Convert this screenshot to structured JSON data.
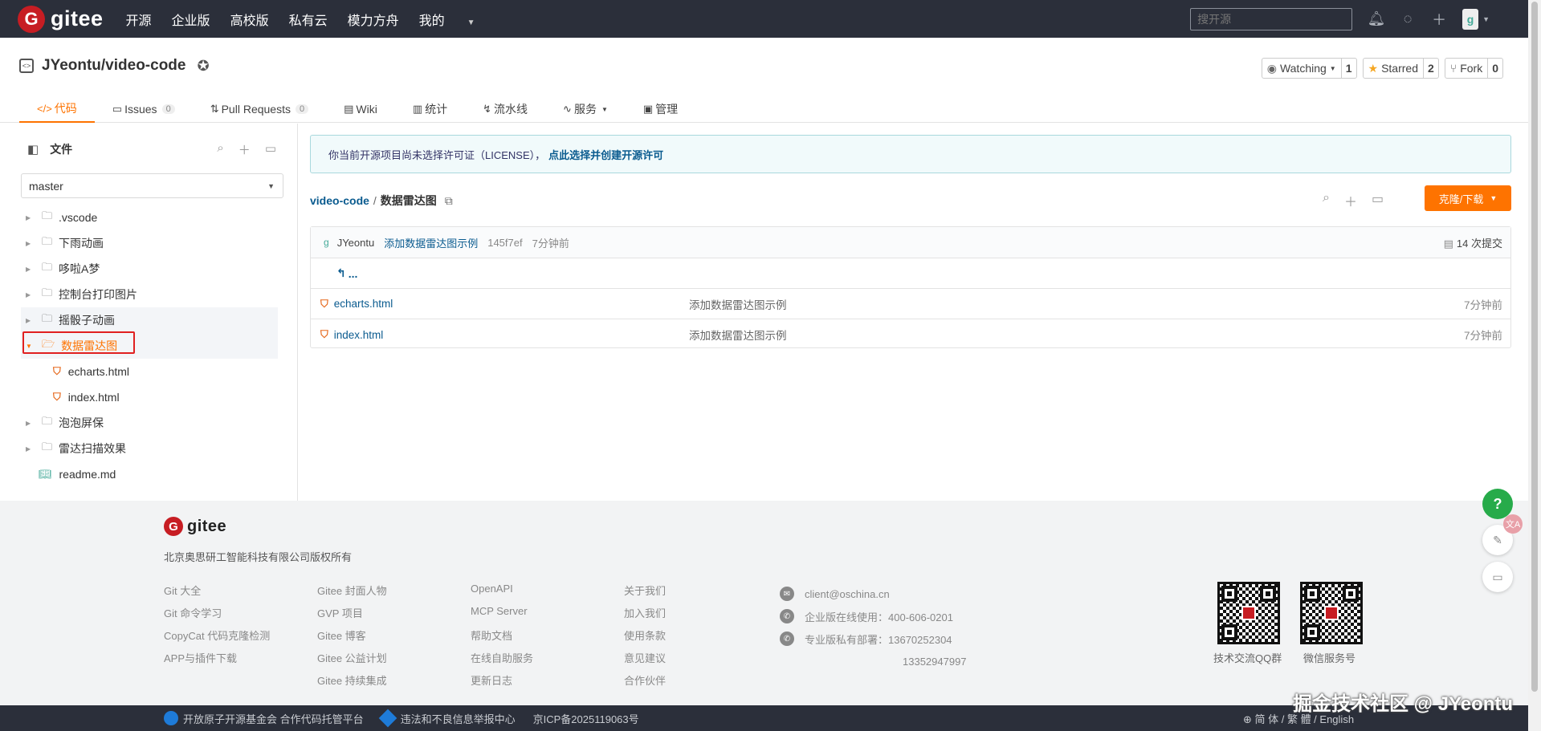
{
  "nav": {
    "logo_mark": "G",
    "logo_text": "gitee",
    "links": [
      "开源",
      "企业版",
      "高校版",
      "私有云",
      "模力方舟",
      "我的"
    ],
    "search_placeholder": "搜开源",
    "avatar_letter": "g"
  },
  "repo": {
    "title": "JYeontu/video-code",
    "watching_label": "Watching",
    "watching_count": "1",
    "starred_label": "Starred",
    "starred_count": "2",
    "fork_label": "Fork",
    "fork_count": "0",
    "tabs": [
      {
        "icon": "</>",
        "label": "代码"
      },
      {
        "icon": "▭",
        "label": "Issues",
        "count": "0"
      },
      {
        "icon": "⇅",
        "label": "Pull Requests",
        "count": "0"
      },
      {
        "icon": "▤",
        "label": "Wiki"
      },
      {
        "icon": "▥",
        "label": "统计"
      },
      {
        "icon": "↯",
        "label": "流水线"
      },
      {
        "icon": "∿",
        "label": "服务"
      },
      {
        "icon": "▣",
        "label": "管理"
      }
    ]
  },
  "sidebar": {
    "title": "文件",
    "branch": "master",
    "tree": [
      {
        "name": ".vscode"
      },
      {
        "name": "下雨动画"
      },
      {
        "name": "哆啦A梦"
      },
      {
        "name": "控制台打印图片"
      },
      {
        "name": "摇骰子动画"
      },
      {
        "name": "数据雷达图"
      },
      {
        "name": "echarts.html"
      },
      {
        "name": "index.html"
      },
      {
        "name": "泡泡屏保"
      },
      {
        "name": "雷达扫描效果"
      },
      {
        "name": "readme.md"
      }
    ]
  },
  "main": {
    "license_text": "你当前开源项目尚未选择许可证（LICENSE），",
    "license_link": "点此选择并创建开源许可",
    "crumb_root": "video-code",
    "crumb_sep": "/",
    "crumb_current": "数据雷达图",
    "clone_label": "克隆/下载",
    "commit": {
      "author": "JYeontu",
      "message": "添加数据雷达图示例",
      "sha": "145f7ef",
      "time": "7分钟前",
      "count": "14 次提交"
    },
    "back_label": "...",
    "files": [
      {
        "name": "echarts.html",
        "message": "添加数据雷达图示例",
        "time": "7分钟前"
      },
      {
        "name": "index.html",
        "message": "添加数据雷达图示例",
        "time": "7分钟前"
      }
    ]
  },
  "footer": {
    "logo_text": "gitee",
    "copyright": "北京奥思研工智能科技有限公司版权所有",
    "col1": [
      "Git 大全",
      "Git 命令学习",
      "CopyCat 代码克隆检测",
      "APP与插件下载"
    ],
    "col2": [
      "Gitee 封面人物",
      "GVP 项目",
      "Gitee 博客",
      "Gitee 公益计划",
      "Gitee 持续集成"
    ],
    "col3": [
      "OpenAPI",
      "MCP Server",
      "帮助文档",
      "在线自助服务",
      "更新日志"
    ],
    "col4": [
      "关于我们",
      "加入我们",
      "使用条款",
      "意见建议",
      "合作伙伴"
    ],
    "email": "client@oschina.cn",
    "phone1": "企业版在线使用：400-606-0201",
    "phone2": "专业版私有部署：13670252304",
    "phone3": "13352947997",
    "qr1_label": "技术交流QQ群",
    "qr2_label": "微信服务号"
  },
  "bottombar": {
    "item1": "开放原子开源基金会  合作代码托管平台",
    "item2": "违法和不良信息举报中心",
    "item3": "京ICP备2025119063号",
    "lang": "简 体 / 繁 體 / English"
  },
  "floating": {
    "help": "?",
    "translate": "文A"
  },
  "watermark": "掘金技术社区 @ JYeontu"
}
